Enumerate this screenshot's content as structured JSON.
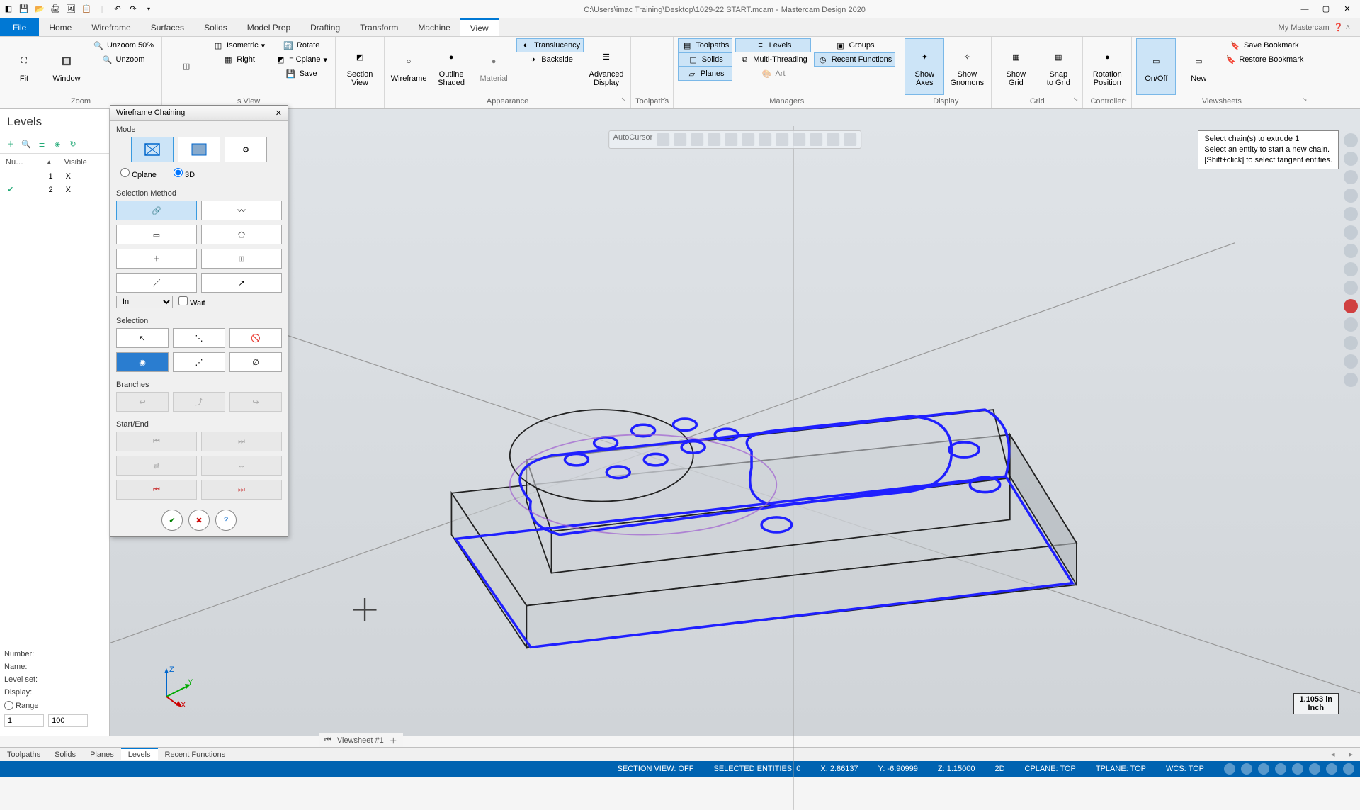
{
  "titlebar": {
    "path": "C:\\Users\\imac Training\\Desktop\\1029-22 START.mcam",
    "app": "Mastercam Design 2020"
  },
  "tabs": {
    "file": "File",
    "home": "Home",
    "wireframe": "Wireframe",
    "surfaces": "Surfaces",
    "solids": "Solids",
    "modelprep": "Model Prep",
    "drafting": "Drafting",
    "transform": "Transform",
    "machine": "Machine",
    "view": "View",
    "mymc": "My Mastercam"
  },
  "ribbon": {
    "zoom": {
      "fit": "Fit",
      "window": "Window",
      "unzoom50": "Unzoom 50%",
      "unzoom": "Unzoom",
      "group": "Zoom"
    },
    "views": {
      "isometric": "Isometric",
      "right": "Right",
      "group": "s View"
    },
    "rotate": "Rotate",
    "cplane": "= Cplane",
    "save": "Save",
    "section": {
      "label": "Section\nView",
      "group": ""
    },
    "appearance": {
      "wireframe": "Wireframe",
      "outline": "Outline\nShaded",
      "material": "Material",
      "translucency": "Translucency",
      "backside": "Backside",
      "adv": "Advanced\nDisplay",
      "group": "Appearance"
    },
    "toolpaths": {
      "group": "Toolpaths"
    },
    "managers": {
      "toolpaths": "Toolpaths",
      "solids": "Solids",
      "planes": "Planes",
      "levels": "Levels",
      "multithread": "Multi-Threading",
      "art": "Art",
      "groups": "Groups",
      "recent": "Recent Functions",
      "group": "Managers"
    },
    "display": {
      "showaxes": "Show\nAxes",
      "showgnomons": "Show\nGnomons",
      "group": "Display"
    },
    "grid": {
      "showgrid": "Show\nGrid",
      "snapgrid": "Snap\nto Grid",
      "group": "Grid"
    },
    "controller": {
      "rotpos": "Rotation\nPosition",
      "group": "Controller"
    },
    "viewsheets": {
      "onoff": "On/Off",
      "new": "New",
      "savebm": "Save Bookmark",
      "restorebm": "Restore Bookmark",
      "group": "Viewsheets"
    }
  },
  "levels": {
    "title": "Levels",
    "cols": {
      "num": "Nu…",
      "vis": "Visible"
    },
    "rows": [
      {
        "n": "1",
        "v": "X",
        "chk": false
      },
      {
        "n": "2",
        "v": "X",
        "chk": true
      }
    ],
    "number": "Number:",
    "name": "Name:",
    "levelset": "Level set:",
    "display": "Display:",
    "range": "Range",
    "range_from": "1",
    "range_to": "100"
  },
  "chaining": {
    "title": "Wireframe Chaining",
    "mode": "Mode",
    "cplane": "Cplane",
    "threed": "3D",
    "selmethod": "Selection Method",
    "in": "In",
    "wait": "Wait",
    "selection": "Selection",
    "branches": "Branches",
    "startend": "Start/End"
  },
  "prompt": {
    "l1": "Select chain(s) to extrude 1",
    "l2": "Select an entity to start a new chain.",
    "l3": "[Shift+click] to select tangent entities."
  },
  "floating_toolbar_label": "AutoCursor",
  "scale": {
    "val": "1.1053 in",
    "unit": "Inch"
  },
  "axis": {
    "z": "Z",
    "y": "Y",
    "x": "X"
  },
  "viewsheet": "Viewsheet #1",
  "bottomtabs": {
    "toolpaths": "Toolpaths",
    "solids": "Solids",
    "planes": "Planes",
    "levels": "Levels",
    "recent": "Recent Functions"
  },
  "status": {
    "section": "SECTION VIEW: OFF",
    "selected": "SELECTED ENTITIES: 0",
    "x": "X: 2.86137",
    "y": "Y: -6.90999",
    "z": "Z: 1.15000",
    "mode": "2D",
    "cplane": "CPLANE: TOP",
    "tplane": "TPLANE: TOP",
    "wcs": "WCS: TOP"
  }
}
